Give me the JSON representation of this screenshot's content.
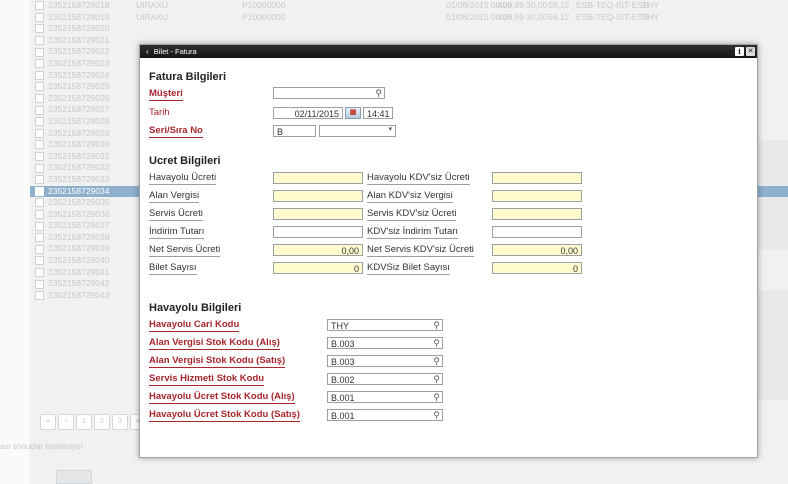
{
  "background_list": {
    "rows": [
      {
        "id": "2352158729018",
        "extra": [
          "UIRAXU",
          "P10000000",
          "01/08/2015 00:00",
          "428,99",
          "30,00",
          "58,12",
          "ESB-TEQ-IST-ESB",
          "THY"
        ]
      },
      {
        "id": "2352158729019",
        "extra": [
          "UIRAXU",
          "P10000000",
          "01/08/2015 00:00",
          "428,99",
          "30,00",
          "58,12",
          "ESB-TEQ-IST-ESB",
          "THY"
        ]
      },
      {
        "id": "2352158729020",
        "extra": []
      },
      {
        "id": "2352158729021",
        "extra": []
      },
      {
        "id": "2352158729022",
        "extra": []
      },
      {
        "id": "2352158729023",
        "extra": []
      },
      {
        "id": "2352158729024",
        "extra": []
      },
      {
        "id": "2352158729025",
        "extra": []
      },
      {
        "id": "2352158729026",
        "extra": []
      },
      {
        "id": "2352158729027",
        "extra": []
      },
      {
        "id": "2352158729028",
        "extra": []
      },
      {
        "id": "2352158729029",
        "extra": []
      },
      {
        "id": "2352158729030",
        "extra": []
      },
      {
        "id": "2352158729031",
        "extra": []
      },
      {
        "id": "2352158729032",
        "extra": []
      },
      {
        "id": "2352158729033",
        "extra": []
      },
      {
        "id": "2352158729034",
        "extra": []
      },
      {
        "id": "2352158729035",
        "extra": []
      },
      {
        "id": "2352158729036",
        "extra": []
      },
      {
        "id": "2352158729037",
        "extra": []
      },
      {
        "id": "2352158729038",
        "extra": []
      },
      {
        "id": "2352158729039",
        "extra": []
      },
      {
        "id": "2352158729040",
        "extra": []
      },
      {
        "id": "2352158729041",
        "extra": []
      },
      {
        "id": "2352158729042",
        "extra": []
      },
      {
        "id": "2352158729043",
        "extra": []
      }
    ],
    "pager": [
      "«",
      "‹",
      "1",
      "2",
      "3",
      "4"
    ],
    "loading_text": "ası sonuçlar listeleniyor"
  },
  "modal": {
    "title": "Bilet - Fatura",
    "back_glyph": "‹",
    "info_label": "i",
    "close_label": "✕",
    "fatura": {
      "heading": "Fatura Bilgileri",
      "musteri_label": "Müşteri",
      "musteri_value": "",
      "tarih_label": "Tarih",
      "tarih_date": "02/11/2015",
      "tarih_time": "14:41",
      "seri_label": "Seri/Sıra No",
      "seri_value": "B",
      "sira_value": ""
    },
    "ucret": {
      "heading": "Ucret Bilgileri",
      "left": [
        {
          "label": "Havayolu Ücreti",
          "value": ""
        },
        {
          "label": "Alan Vergisi",
          "value": ""
        },
        {
          "label": "Servis Ücreti",
          "value": ""
        },
        {
          "label": "İndirim Tutarı",
          "value": ""
        },
        {
          "label": "Net Servis Ücreti",
          "value": "0,00"
        },
        {
          "label": "Bilet Sayısı",
          "value": "0"
        }
      ],
      "right": [
        {
          "label": "Havayolu KDV'siz Ücreti",
          "value": ""
        },
        {
          "label": "Alan KDV'siz Vergisi",
          "value": ""
        },
        {
          "label": "Servis KDV'siz Ücreti",
          "value": ""
        },
        {
          "label": "KDV'siz İndirim Tutarı",
          "value": ""
        },
        {
          "label": "Net Servis KDV'siz Ücreti",
          "value": "0,00"
        },
        {
          "label": "KDVSiz Bilet Sayısı",
          "value": "0"
        }
      ]
    },
    "havayolu": {
      "heading": "Havayolu Bilgileri",
      "rows": [
        {
          "label": "Havayolu Cari Kodu",
          "value": "THY"
        },
        {
          "label": "Alan Vergisi Stok Kodu (Alış)",
          "value": "B.003"
        },
        {
          "label": "Alan Vergisi Stok Kodu (Satış)",
          "value": "B.003"
        },
        {
          "label": "Servis Hizmeti Stok Kodu",
          "value": "B.002"
        },
        {
          "label": "Havayolu Ücret Stok Kodu (Alış)",
          "value": "B.001"
        },
        {
          "label": "Havayolu Ücret Stok Kodu (Satış)",
          "value": "B.001"
        }
      ]
    }
  }
}
